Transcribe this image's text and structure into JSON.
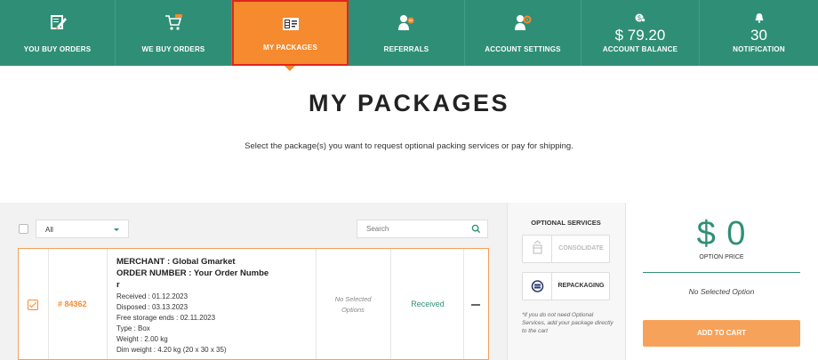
{
  "nav": {
    "items": [
      {
        "label": "YOU BUY ORDERS",
        "icon": "pencil-doc-icon"
      },
      {
        "label": "WE BUY ORDERS",
        "icon": "cart-hand-icon"
      },
      {
        "label": "MY PACKAGES",
        "icon": "package-list-icon",
        "active": true
      },
      {
        "label": "REFERRALS",
        "icon": "people-icon"
      },
      {
        "label": "ACCOUNT SETTINGS",
        "icon": "people-gear-icon"
      },
      {
        "label": "ACCOUNT BALANCE",
        "value": "$ 79.20",
        "icon": "coin-icon"
      },
      {
        "label": "NOTIFICATION",
        "value": "30",
        "icon": "bell-icon"
      }
    ]
  },
  "page": {
    "title": "MY PACKAGES",
    "subtitle": "Select the package(s) you want to request optional packing services or pay for shipping."
  },
  "filters": {
    "select_value": "All",
    "search_placeholder": "Search"
  },
  "package": {
    "id": "# 84362",
    "merchant_line": "MERCHANT : Global Gmarket",
    "order_line": "ORDER NUMBER : Your Order Numbe",
    "order_line_wrap": "r",
    "received": "Received : 01.12.2023",
    "disposed": "Disposed : 03.13.2023",
    "free_storage": "Free storage ends : 02.11.2023",
    "type": "Type : Box",
    "weight": "Weight : 2.00 kg",
    "dim_weight": "Dim weight : 4.20 kg (20 x 30 x 35)",
    "options_line1": "No Selected",
    "options_line2": "Options",
    "status": "Received"
  },
  "optional_services": {
    "title": "OPTIONAL SERVICES",
    "consolidate": "CONSOLIDATE",
    "repackaging": "REPACKAGING",
    "note": "*if you do not need Optional Services, add your package directly to the cart"
  },
  "price": {
    "value": "$ 0",
    "label": "OPTION PRICE",
    "selection": "No Selected Option",
    "cart_button": "ADD TO CART"
  },
  "colors": {
    "brand_green": "#2f8f76",
    "accent_orange": "#f58a2e",
    "active_border": "#e0261e"
  }
}
